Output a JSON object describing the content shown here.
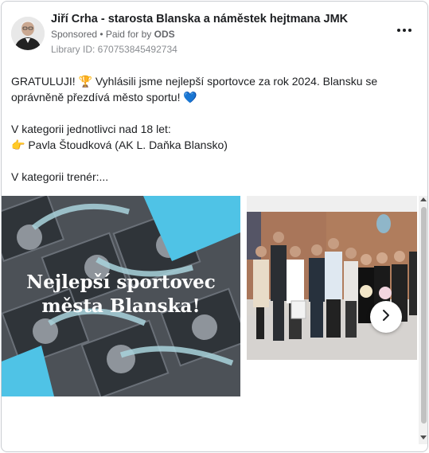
{
  "post": {
    "author": "Jiří Crha - starosta Blanska a náměstek hejtmana JMK",
    "sponsored": "Sponsored",
    "paid_prefix": "• Paid for by",
    "paid_by": "ODS",
    "library_id": "Library ID: 670753845492734",
    "more_icon": "more-horizontal-icon"
  },
  "body": {
    "line1": "GRATULUJI! 🏆 Vyhlásili jsme nejlepší sportovce za rok 2024. Blansku se oprávněně přezdívá město sportu! 💙",
    "line2": "V kategorii jednotlivci nad 18 let:",
    "line3": "👉 Pavla Štoudková (AK L. Daňka Blansko)",
    "line4": "V kategorii trenér:..."
  },
  "carousel": {
    "slide1_title_line1": "Nejlepší sportovec",
    "slide1_title_line2": "města Blanska!",
    "next_icon": "chevron-right-icon"
  },
  "colors": {
    "accent_cyan": "#4fc3e6",
    "text": "#1c1e21",
    "muted": "#65676b"
  }
}
